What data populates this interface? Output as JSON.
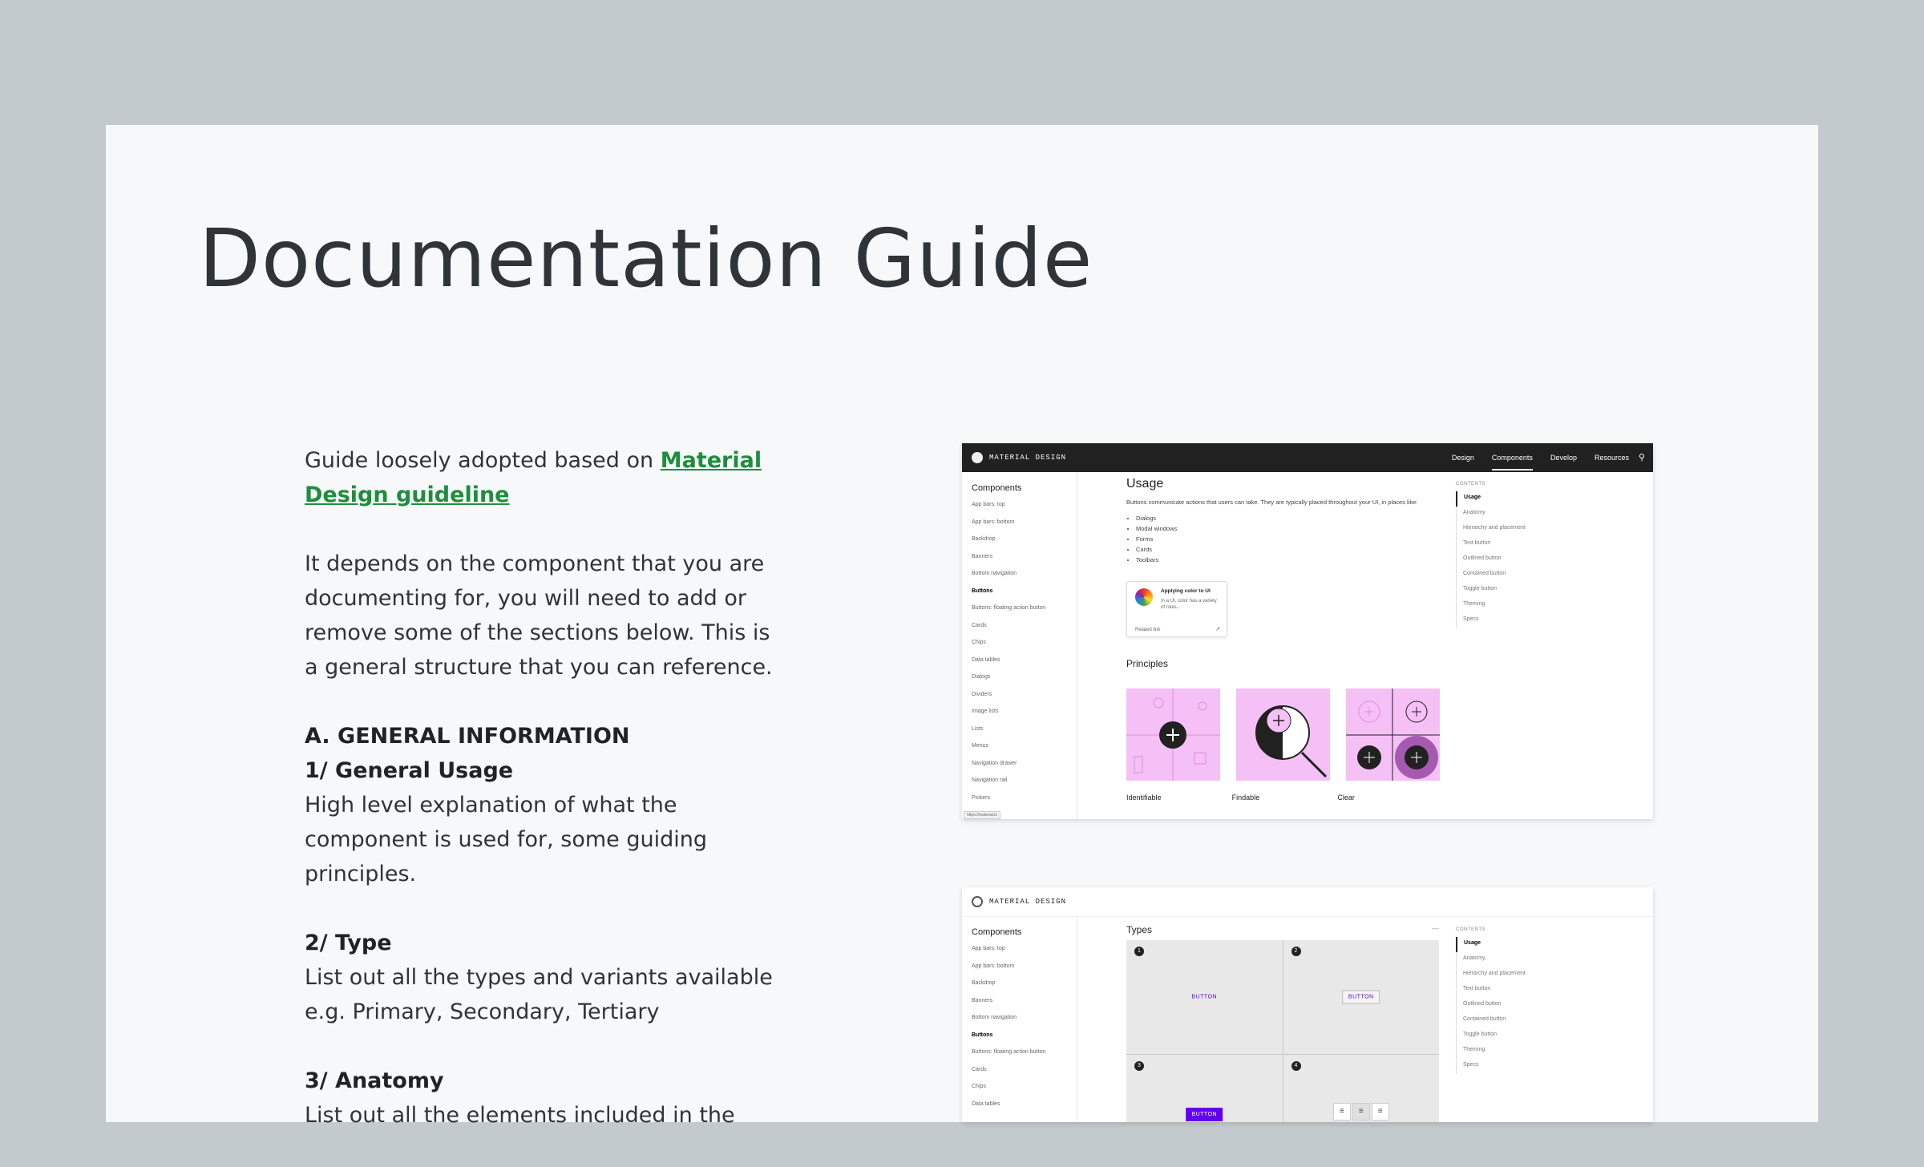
{
  "title": "Documentation Guide",
  "intro": {
    "prefix": "Guide loosely adopted based on ",
    "link": "Material Design guideline"
  },
  "paragraph": "It depends on the component that you are documenting for, you will need to add or remove some of the sections below. This is a general structure that you can reference.",
  "sections": {
    "a_heading": "A. GENERAL INFORMATION",
    "s1_heading": "1/ General Usage",
    "s1_text": "High level explanation of what the component is used for, some guiding principles.",
    "s2_heading": "2/ Type",
    "s2_text": "List out all the types and variants available e.g. Primary, Secondary, Tertiary",
    "s3_heading": "3/ Anatomy",
    "s3_text": "List out all the elements included in the"
  },
  "shot1": {
    "brand": "MATERIAL DESIGN",
    "nav": [
      "Design",
      "Components",
      "Develop",
      "Resources"
    ],
    "side_heading": "Components",
    "side_items": [
      "App bars: top",
      "App bars: bottom",
      "Backdrop",
      "Banners",
      "Bottom navigation",
      "Buttons",
      "Buttons: floating action button",
      "Cards",
      "Chips",
      "Data tables",
      "Dialogs",
      "Dividers",
      "Image lists",
      "Lists",
      "Menus",
      "Navigation drawer",
      "Navigation rail",
      "Pickers"
    ],
    "usage_title": "Usage",
    "usage_text": "Buttons communicate actions that users can take. They are typically placed throughout your UI, in places like:",
    "usage_list": [
      "Dialogs",
      "Modal windows",
      "Forms",
      "Cards",
      "Toolbars"
    ],
    "card_title": "Applying color to UI",
    "card_text": "In a UI, color has a variety of roles...",
    "card_link": "Related link",
    "principles": "Principles",
    "tile_labels": [
      "Identifiable",
      "Findable",
      "Clear"
    ],
    "toc_heading": "CONTENTS",
    "toc_items": [
      "Usage",
      "Anatomy",
      "Hierarchy and placement",
      "Text button",
      "Outlined button",
      "Contained button",
      "Toggle button",
      "Theming",
      "Specs"
    ],
    "url": "https://material.io"
  },
  "shot2": {
    "brand": "MATERIAL DESIGN",
    "side_heading": "Components",
    "side_items": [
      "App bars: top",
      "App bars: bottom",
      "Backdrop",
      "Banners",
      "Bottom navigation",
      "Buttons",
      "Buttons: floating action button",
      "Cards",
      "Chips",
      "Data tables"
    ],
    "types_title": "Types",
    "nums": [
      "1",
      "2",
      "3",
      "4"
    ],
    "button_label": "BUTTON",
    "toc_heading": "CONTENTS",
    "toc_items": [
      "Usage",
      "Anatomy",
      "Hierarchy and placement",
      "Text button",
      "Outlined button",
      "Contained button",
      "Toggle button",
      "Theming",
      "Specs"
    ]
  }
}
